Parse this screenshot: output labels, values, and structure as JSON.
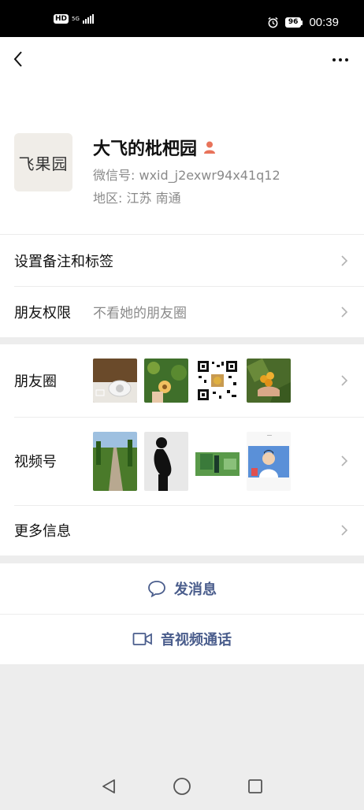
{
  "status_bar": {
    "hd": "HD",
    "network": "5G",
    "battery": "96",
    "time": "00:39"
  },
  "profile": {
    "avatar_text": "飞果园",
    "name": "大飞的枇杷园",
    "wechat_id": "微信号:  wxid_j2exwr94x41q12",
    "region": "地区:  江苏  南通"
  },
  "rows": {
    "remark": "设置备注和标签",
    "permissions_label": "朋友权限",
    "permissions_value": "不看她的朋友圈",
    "moments_label": "朋友圈",
    "channels_label": "视频号",
    "more_info": "更多信息"
  },
  "actions": {
    "message": "发消息",
    "call": "音视频通话"
  },
  "colors": {
    "accent": "#4a5d8c",
    "secondary_text": "#8a8a8a",
    "gender_icon": "#e8735a"
  }
}
